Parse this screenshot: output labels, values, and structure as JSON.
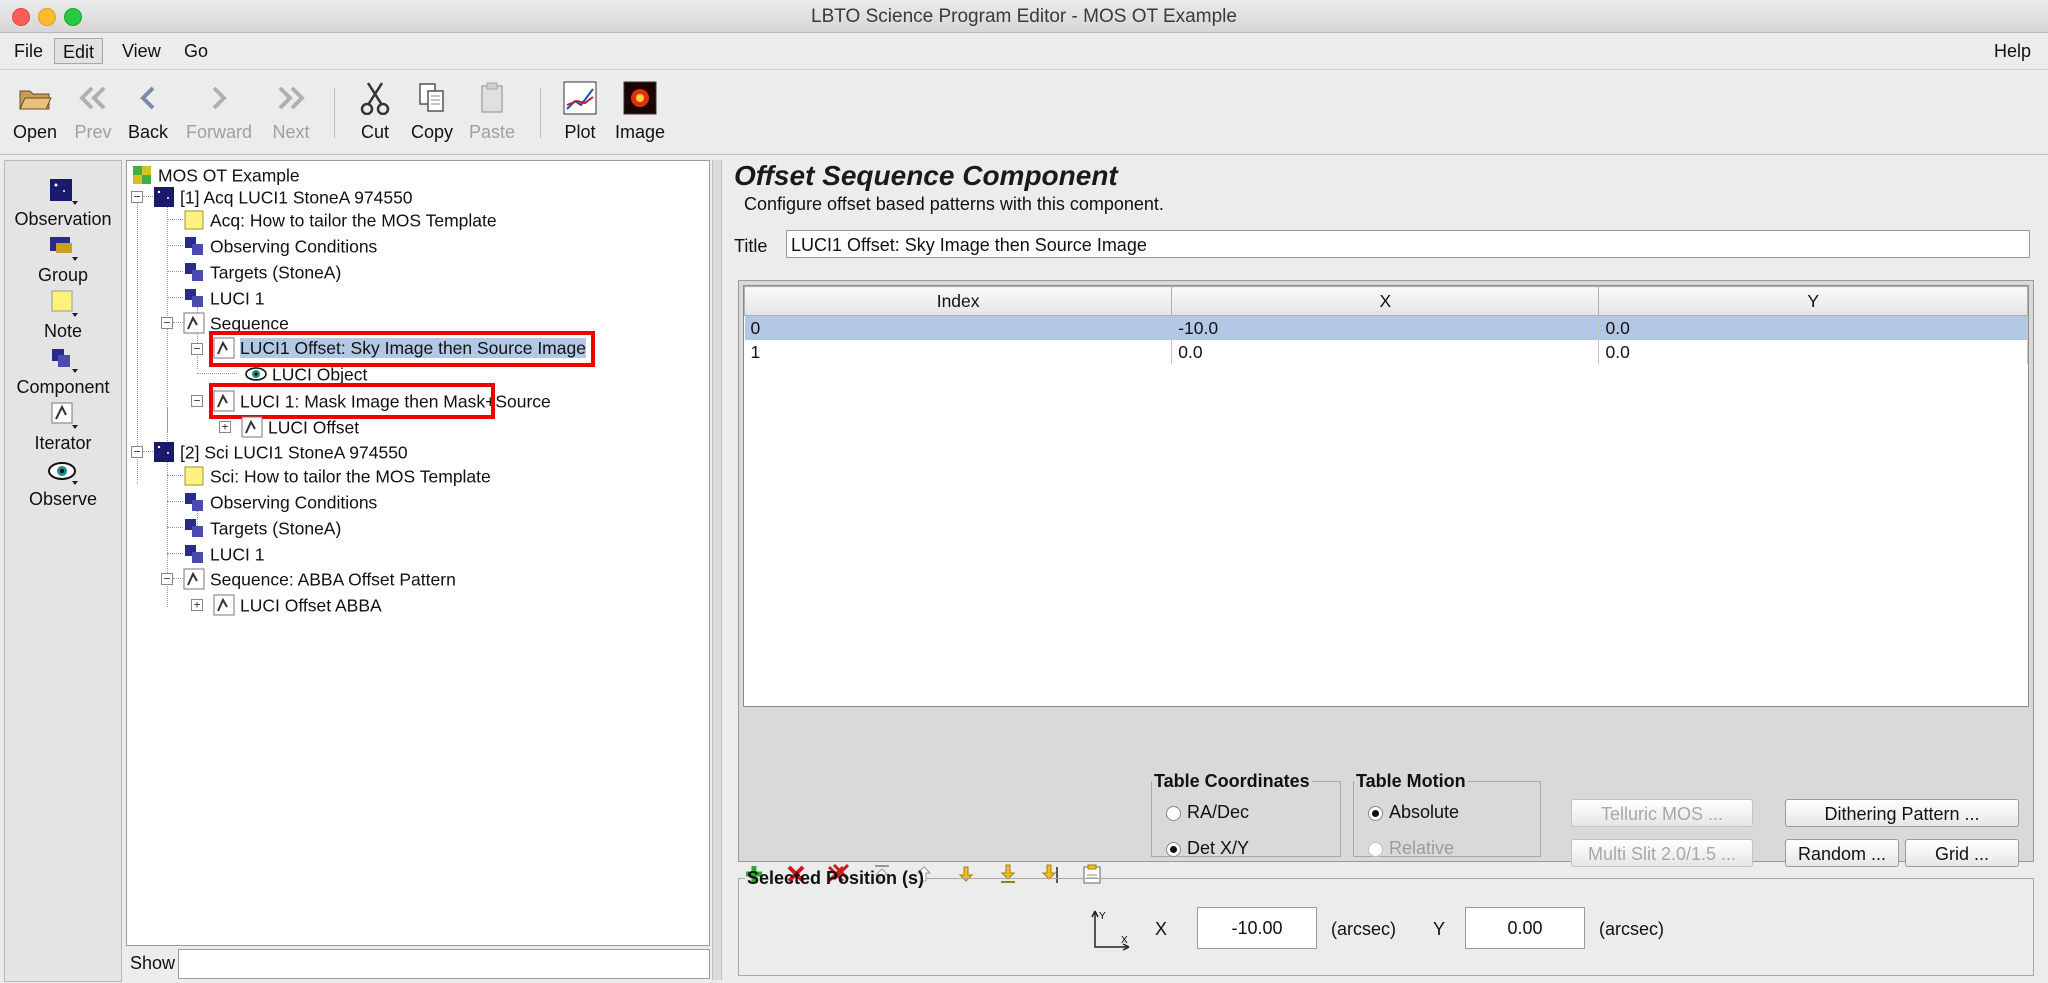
{
  "window": {
    "title": "LBTO Science Program Editor - MOS OT Example"
  },
  "menubar": {
    "file": "File",
    "edit": "Edit",
    "view": "View",
    "go": "Go",
    "help": "Help"
  },
  "toolbar": {
    "open": "Open",
    "prev": "Prev",
    "back": "Back",
    "forward": "Forward",
    "next": "Next",
    "cut": "Cut",
    "copy": "Copy",
    "paste": "Paste",
    "plot": "Plot",
    "image": "Image"
  },
  "palette": {
    "observation": "Observation",
    "group": "Group",
    "note": "Note",
    "component": "Component",
    "iterator": "Iterator",
    "observe": "Observe"
  },
  "tree": {
    "root": "MOS OT Example",
    "n1": "[1] Acq LUCI1 StoneA 974550",
    "n1_note": "Acq: How to tailor the MOS Template",
    "n1_cond": "Observing Conditions",
    "n1_targets": "Targets (StoneA)",
    "n1_luci": "LUCI 1",
    "n1_seq": "Sequence",
    "n1_off1": "LUCI1 Offset: Sky Image then Source Image",
    "n1_obj": "LUCI Object",
    "n1_off2": "LUCI 1: Mask Image then Mask+Source",
    "n1_off3": "LUCI Offset",
    "n2": "[2] Sci LUCI1 StoneA 974550",
    "n2_note": "Sci: How to tailor the MOS Template",
    "n2_cond": "Observing Conditions",
    "n2_targets": "Targets (StoneA)",
    "n2_luci": "LUCI 1",
    "n2_seq": "Sequence: ABBA Offset Pattern",
    "n2_abba": "LUCI Offset ABBA"
  },
  "show": {
    "label": "Show",
    "value": ""
  },
  "editor": {
    "heading": "Offset Sequence Component",
    "description": "Configure offset based patterns with this component.",
    "title_label": "Title",
    "title_value": "LUCI1 Offset: Sky Image then Source Image"
  },
  "table": {
    "headers": [
      "Index",
      "X",
      "Y"
    ],
    "rows": [
      [
        "0",
        "-10.0",
        "0.0"
      ],
      [
        "1",
        "0.0",
        "0.0"
      ]
    ]
  },
  "coords": {
    "legend": "Table Coordinates",
    "radec": "RA/Dec",
    "detxy": "Det X/Y",
    "selected": "Det X/Y"
  },
  "motion": {
    "legend": "Table Motion",
    "absolute": "Absolute",
    "relative": "Relative",
    "selected": "Absolute"
  },
  "buttons": {
    "telluric": "Telluric MOS ...",
    "multislit": "Multi Slit 2.0/1.5 ...",
    "dither": "Dithering Pattern ...",
    "random": "Random ...",
    "grid": "Grid ..."
  },
  "selpos": {
    "legend": "Selected Position (s)",
    "x_label": "X",
    "x_value": "-10.00",
    "x_unit": "(arcsec)",
    "y_label": "Y",
    "y_value": "0.00",
    "y_unit": "(arcsec)"
  },
  "colors": {
    "selection": "#b3c8e4",
    "highlight": "#ee0000"
  }
}
